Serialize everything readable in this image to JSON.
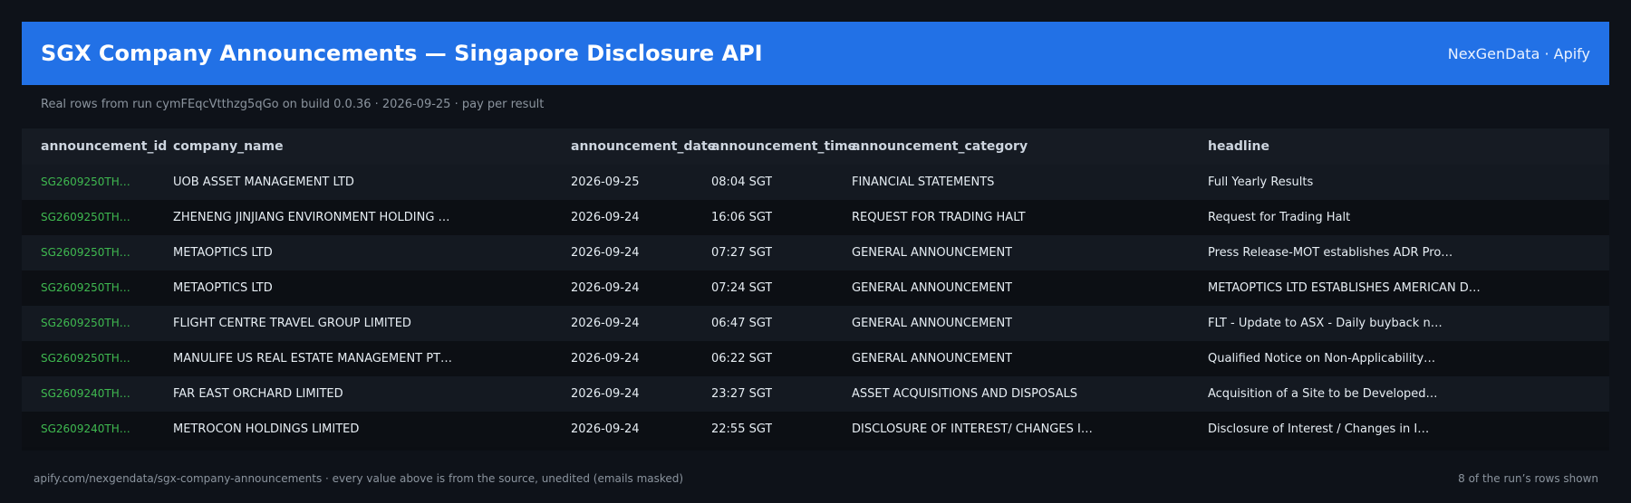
{
  "header": {
    "title": "SGX Company Announcements — Singapore Disclosure API",
    "brand": "NexGenData · Apify",
    "accent_color": "#2271e6"
  },
  "subtitle": "Real rows from run cymFEqcVtthzg5qGo on build 0.0.36 · 2026-09-25 · pay per result",
  "table": {
    "columns": [
      "announcement_id",
      "company_name",
      "announcement_date",
      "announcement_time",
      "announcement_category",
      "headline"
    ],
    "rows": [
      [
        "SG2609250TH…",
        "UOB ASSET MANAGEMENT LTD",
        "2026-09-25",
        "08:04 SGT",
        "FINANCIAL STATEMENTS",
        "Full Yearly Results"
      ],
      [
        "SG2609250TH…",
        "ZHENENG JINJIANG ENVIRONMENT HOLDING …",
        "2026-09-24",
        "16:06 SGT",
        "REQUEST FOR TRADING HALT",
        "Request for Trading Halt"
      ],
      [
        "SG2609250TH…",
        "METAOPTICS LTD",
        "2026-09-24",
        "07:27 SGT",
        "GENERAL ANNOUNCEMENT",
        "Press Release-MOT establishes ADR Pro…"
      ],
      [
        "SG2609250TH…",
        "METAOPTICS LTD",
        "2026-09-24",
        "07:24 SGT",
        "GENERAL ANNOUNCEMENT",
        "METAOPTICS LTD ESTABLISHES AMERICAN D…"
      ],
      [
        "SG2609250TH…",
        "FLIGHT CENTRE TRAVEL GROUP LIMITED",
        "2026-09-24",
        "06:47 SGT",
        "GENERAL ANNOUNCEMENT",
        "FLT - Update to ASX - Daily buyback n…"
      ],
      [
        "SG2609250TH…",
        "MANULIFE US REAL ESTATE MANAGEMENT PT…",
        "2026-09-24",
        "06:22 SGT",
        "GENERAL ANNOUNCEMENT",
        "Qualified Notice on Non-Applicability…"
      ],
      [
        "SG2609240TH…",
        "FAR EAST ORCHARD LIMITED",
        "2026-09-24",
        "23:27 SGT",
        "ASSET ACQUISITIONS AND DISPOSALS",
        "Acquisition of a Site to be Developed…"
      ],
      [
        "SG2609240TH…",
        "METROCON HOLDINGS LIMITED",
        "2026-09-24",
        "22:55 SGT",
        "DISCLOSURE OF INTEREST/ CHANGES I…",
        "Disclosure of Interest / Changes in I…"
      ]
    ],
    "id_color": "#3fb950"
  },
  "footer": {
    "source": "apify.com/nexgendata/sgx-company-announcements  ·  every value above is from the source, unedited (emails masked)",
    "count": "8 of the run’s rows shown"
  }
}
